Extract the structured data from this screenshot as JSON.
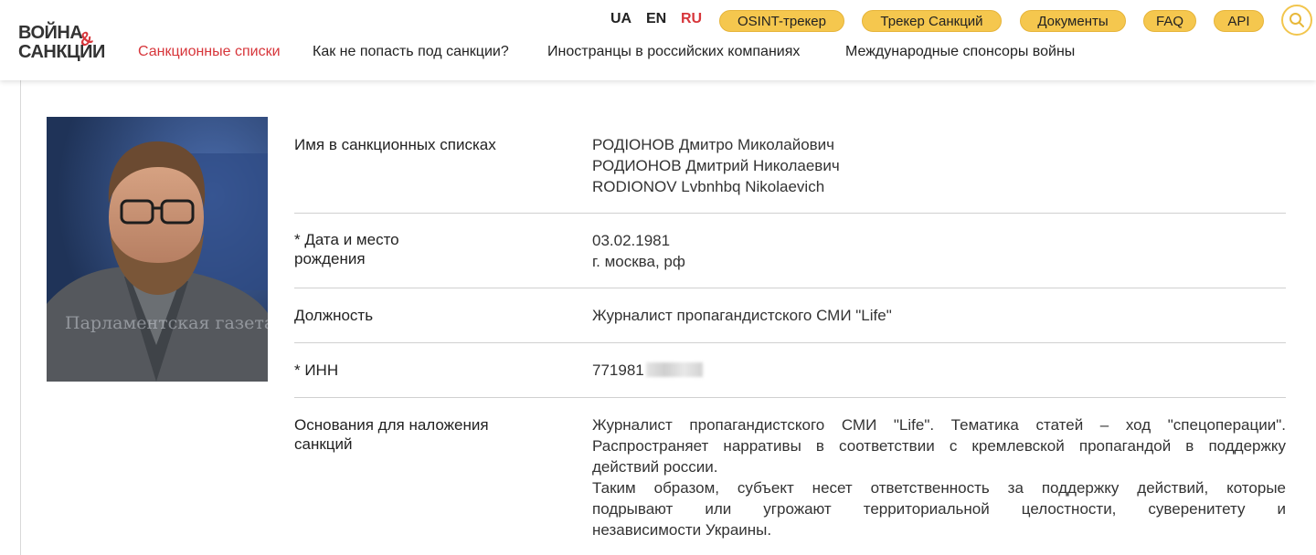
{
  "header": {
    "logo": {
      "line1": "ВОЙНА",
      "amp": "&",
      "line2": "САНКЦИИ"
    },
    "languages": [
      {
        "label": "UA",
        "active": false
      },
      {
        "label": "EN",
        "active": false
      },
      {
        "label": "RU",
        "active": true
      }
    ],
    "pills": [
      "OSINT-трекер",
      "Трекер Санкций",
      "Документы",
      "FAQ",
      "API"
    ],
    "nav": [
      {
        "label": "Санкционные списки",
        "active": true
      },
      {
        "label": "Как не попасть под санкции?",
        "active": false
      },
      {
        "label": "Иностранцы в российских компаниях",
        "active": false
      },
      {
        "label": "Международные спонсоры войны",
        "active": false
      }
    ],
    "search_icon": "search-icon"
  },
  "profile": {
    "photo_watermark": "Парламентская газета",
    "rows": [
      {
        "label": "Имя в санкционных списках",
        "values": [
          "РОДІОНОВ Дмитро Миколайович",
          "РОДИОНОВ Дмитрий Николаевич",
          "RODIONOV Lvbnhbq Nikolaevich"
        ]
      },
      {
        "label_line1": "* Дата и место",
        "label_line2": "рождения",
        "values": [
          "03.02.1981",
          "г. москва, рф"
        ]
      },
      {
        "label": "Должность",
        "values": [
          "Журналист пропагандистского СМИ \"Life\""
        ]
      },
      {
        "label": "* ИНН",
        "value_visible": "771981"
      },
      {
        "label_line1": "Основания для наложения",
        "label_line2": "санкций",
        "lines": [
          "Журналист пропагандистского СМИ \"Life\". Тематика статей – ход \"спецоперации\".",
          "Распространяет нарративы в соответствии с кремлевской пропагандой в поддержку",
          "действий россии.",
          "Таким образом, субъект несет ответственность за поддержку действий, которые",
          "подрывают или угрожают территориальной целостности, суверенитету и",
          "независимости Украины."
        ]
      }
    ]
  }
}
